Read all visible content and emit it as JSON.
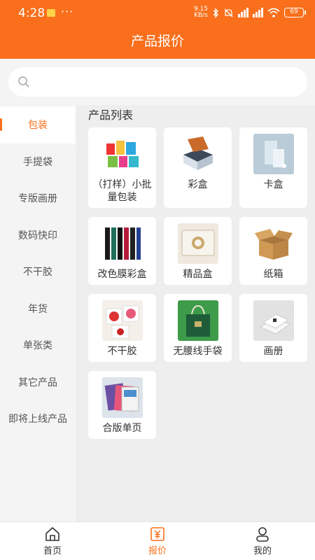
{
  "status_bar": {
    "time": "4:28",
    "dots": "···",
    "speed_top": "9.15",
    "speed_bottom": "KB/s",
    "battery": "69"
  },
  "header": {
    "title": "产品报价"
  },
  "search": {
    "placeholder": ""
  },
  "sidebar": {
    "items": [
      {
        "label": "包装"
      },
      {
        "label": "手提袋"
      },
      {
        "label": "专版画册"
      },
      {
        "label": "数码快印"
      },
      {
        "label": "不干胶"
      },
      {
        "label": "年货"
      },
      {
        "label": "单张类"
      },
      {
        "label": "其它产品"
      },
      {
        "label": "即将上线产品"
      }
    ]
  },
  "main": {
    "section_title": "产品列表",
    "products": [
      {
        "label": "（打样）小批量包装",
        "icon": "small-batch-packaging-image"
      },
      {
        "label": "彩盒",
        "icon": "color-box-image"
      },
      {
        "label": "卡盒",
        "icon": "card-box-image"
      },
      {
        "label": "改色膜彩盒",
        "icon": "wrap-film-box-image"
      },
      {
        "label": "精品盒",
        "icon": "gift-box-image"
      },
      {
        "label": "纸箱",
        "icon": "carton-image"
      },
      {
        "label": "不干胶",
        "icon": "sticker-image"
      },
      {
        "label": "无腰线手袋",
        "icon": "handbag-image"
      },
      {
        "label": "画册",
        "icon": "brochure-image"
      },
      {
        "label": "合版单页",
        "icon": "flyer-image"
      }
    ]
  },
  "tabbar": {
    "tabs": [
      {
        "label": "首页",
        "icon": "home-icon"
      },
      {
        "label": "报价",
        "icon": "price-icon"
      },
      {
        "label": "我的",
        "icon": "user-icon"
      }
    ]
  },
  "colors": {
    "accent": "#f96f1c",
    "background": "#f4f4f4"
  }
}
